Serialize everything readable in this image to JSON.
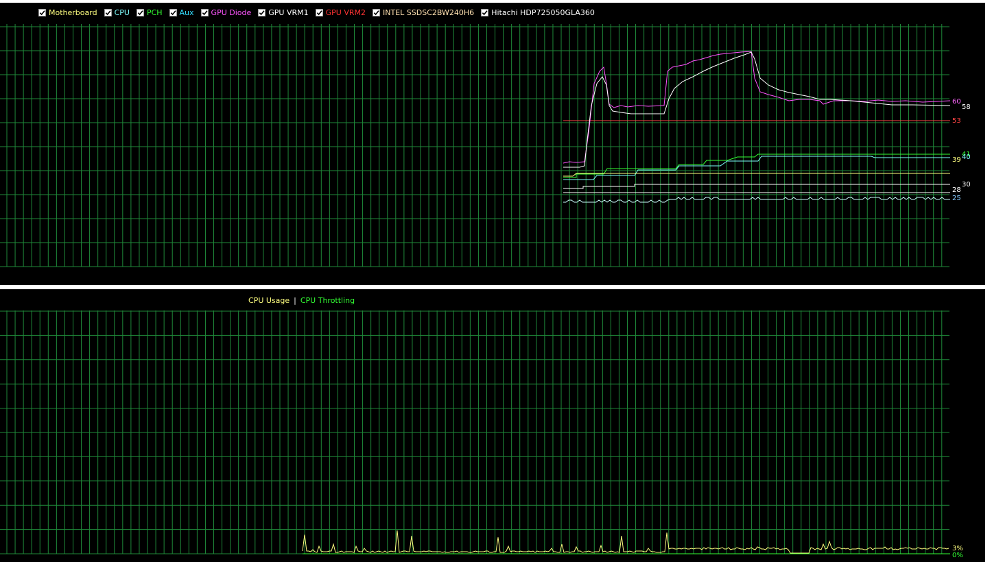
{
  "temperature_panel": {
    "legend": [
      {
        "label": "Motherboard",
        "color": "#ffff80",
        "checked": true
      },
      {
        "label": "CPU",
        "color": "#80ffff",
        "checked": true
      },
      {
        "label": "PCH",
        "color": "#33ff33",
        "checked": true
      },
      {
        "label": "Aux",
        "color": "#33ddff",
        "checked": true
      },
      {
        "label": "GPU Diode",
        "color": "#ff55ff",
        "checked": true
      },
      {
        "label": "GPU VRM1",
        "color": "#ffffff",
        "checked": true
      },
      {
        "label": "GPU VRM2",
        "color": "#ff3333",
        "checked": true
      },
      {
        "label": "INTEL SSDSC2BW240H6",
        "color": "#ffe0b0",
        "checked": true
      },
      {
        "label": "Hitachi HDP725050GLA360",
        "color": "#ffffff",
        "checked": true
      }
    ],
    "grid_color": "#1f8a3a",
    "value_labels": [
      {
        "text": "60",
        "color": "#ff66ff"
      },
      {
        "text": "58",
        "color": "#ffffff"
      },
      {
        "text": "53",
        "color": "#ff4444"
      },
      {
        "text": "41",
        "color": "#33ff33"
      },
      {
        "text": "39",
        "color": "#ffff80"
      },
      {
        "text": "40",
        "color": "#80ffff"
      },
      {
        "text": "30",
        "color": "#ffffff"
      },
      {
        "text": "28",
        "color": "#ffffff"
      },
      {
        "text": "25",
        "color": "#88ccff"
      }
    ]
  },
  "cpu_panel": {
    "legend_usage": "CPU Usage",
    "legend_separator": "|",
    "legend_throttling": "CPU Throttling",
    "usage_color": "#ffff80",
    "throttling_color": "#33ff33",
    "value_labels": [
      {
        "text": "3%",
        "color": "#ffff80"
      },
      {
        "text": "0%",
        "color": "#33ff33"
      }
    ]
  }
}
